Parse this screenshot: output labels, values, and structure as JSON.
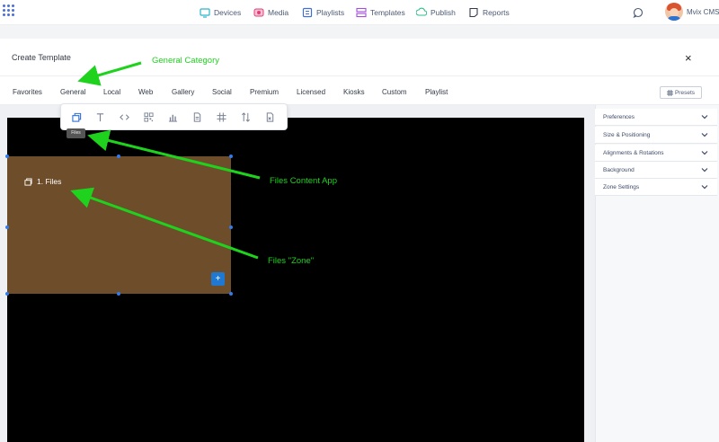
{
  "nav": {
    "items": [
      {
        "label": "Devices",
        "icon": "monitor-icon",
        "color": "#2bb3c9"
      },
      {
        "label": "Media",
        "icon": "media-icon",
        "color": "#e0407a"
      },
      {
        "label": "Playlists",
        "icon": "playlist-icon",
        "color": "#3f6fd6"
      },
      {
        "label": "Templates",
        "icon": "templates-icon",
        "color": "#a24fd6"
      },
      {
        "label": "Publish",
        "icon": "publish-icon",
        "color": "#2bbf8a"
      },
      {
        "label": "Reports",
        "icon": "reports-icon",
        "color": "#333a47"
      }
    ],
    "user": "Mvix CMS"
  },
  "modal": {
    "title": "Create Template",
    "close": "×",
    "tabs": [
      "Favorites",
      "General",
      "Local",
      "Web",
      "Gallery",
      "Social",
      "Premium",
      "Licensed",
      "Kiosks",
      "Custom",
      "Playlist"
    ],
    "presets_label": "Presets"
  },
  "toolbar": {
    "tools": [
      "files-icon",
      "text-icon",
      "code-icon",
      "qr-icon",
      "chart-icon",
      "document-icon",
      "grid-icon",
      "sort-icon",
      "spreadsheet-icon"
    ],
    "tooltip": "Files"
  },
  "zone": {
    "label": "1. Files",
    "add": "+",
    "color": "#6e4e2a"
  },
  "sidebar": {
    "sections": [
      "Preferences",
      "Size & Positioning",
      "Alignments & Rotations",
      "Background",
      "Zone Settings"
    ]
  },
  "annotations": {
    "general_category": "General Category",
    "files_app": "Files Content App",
    "files_zone": "Files \"Zone\"",
    "color": "#1ed21e"
  }
}
